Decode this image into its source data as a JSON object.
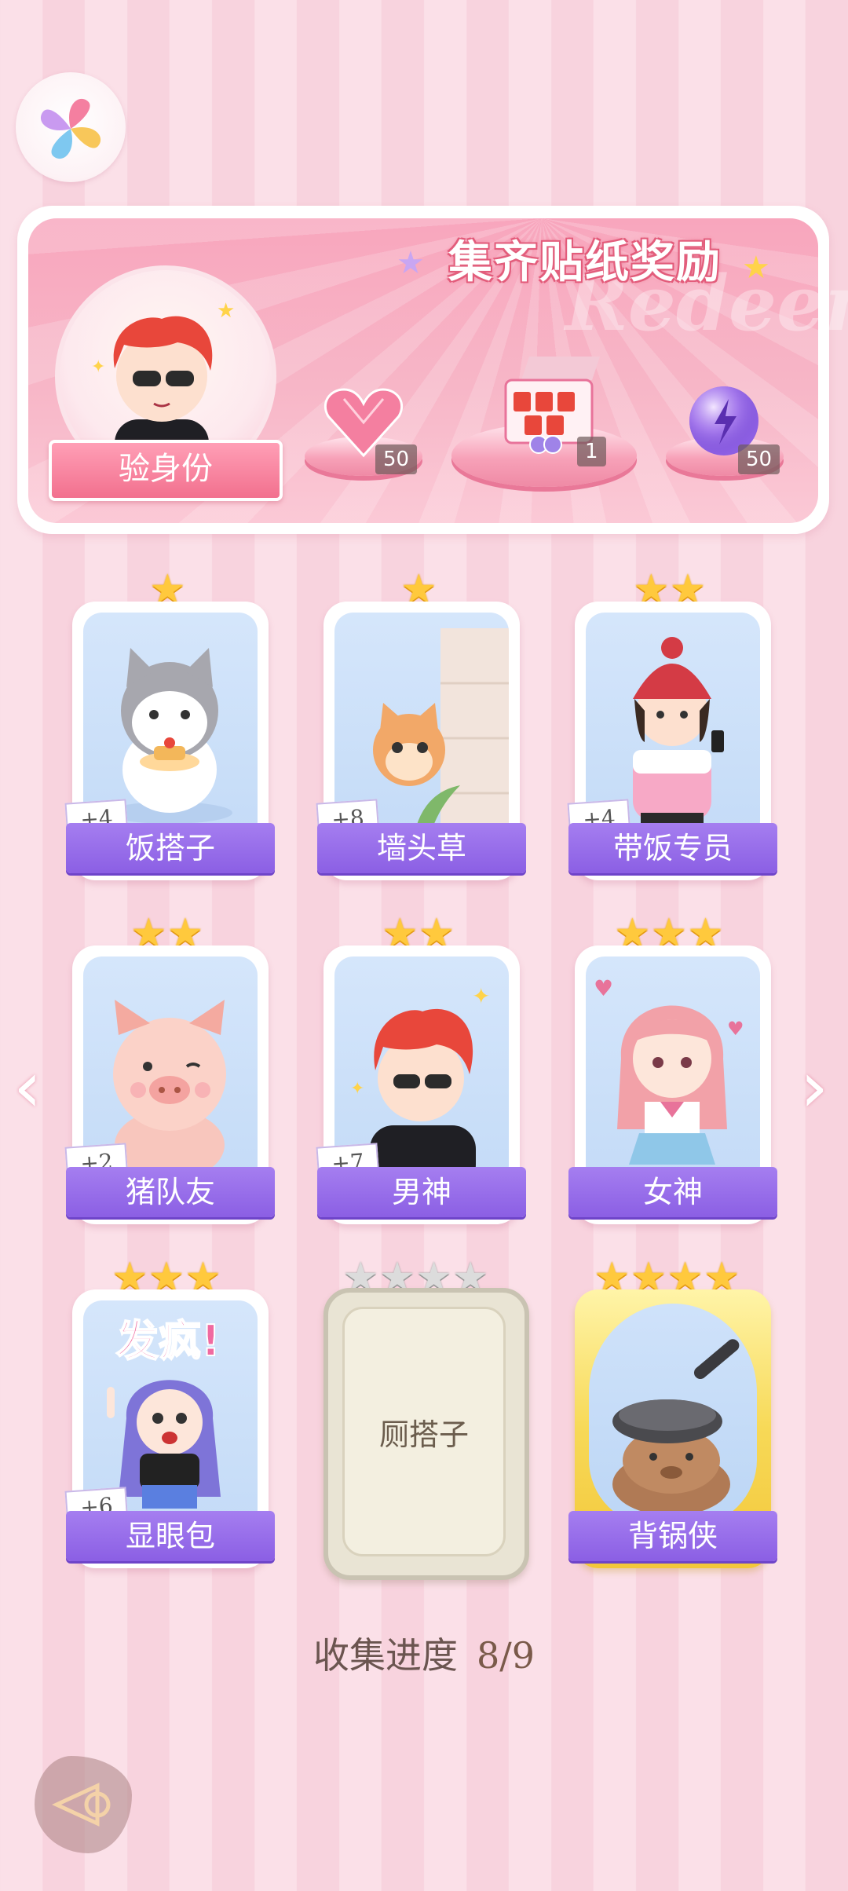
{
  "banner": {
    "title": "集齐贴纸奖励",
    "watermark": "Redeem",
    "identity_button": "验身份",
    "rewards": [
      {
        "icon": "pink-heart-gem-icon",
        "count": "50"
      },
      {
        "icon": "gift-box-icon",
        "count": "1"
      },
      {
        "icon": "purple-energy-orb-icon",
        "count": "50"
      }
    ]
  },
  "stickers": [
    {
      "name": "饭搭子",
      "bonus": "+4",
      "stars": 1,
      "art": "cat-with-pancake"
    },
    {
      "name": "墙头草",
      "bonus": "+8",
      "stars": 1,
      "art": "cat-behind-wall"
    },
    {
      "name": "带饭专员",
      "bonus": "+4",
      "stars": 2,
      "art": "girl-with-beanie"
    },
    {
      "name": "猪队友",
      "bonus": "+2",
      "stars": 2,
      "art": "pink-pig"
    },
    {
      "name": "男神",
      "bonus": "+7",
      "stars": 2,
      "art": "red-hair-boy"
    },
    {
      "name": "女神",
      "bonus": "",
      "stars": 3,
      "art": "pink-hair-girl"
    },
    {
      "name": "显眼包",
      "bonus": "+6",
      "stars": 3,
      "art": "purple-hair-girl",
      "art_text": "发疯!"
    },
    {
      "name": "厕搭子",
      "bonus": "",
      "stars": 4,
      "locked": true
    },
    {
      "name": "背锅侠",
      "bonus": "",
      "stars": 4,
      "art": "capybara-with-pan",
      "gold": true
    }
  ],
  "progress": {
    "label": "收集进度",
    "value": "8/9"
  },
  "colors": {
    "accent_purple": "#8b5fe4",
    "banner_pink": "#f7a1b8",
    "star_gold": "#ffc93d"
  }
}
